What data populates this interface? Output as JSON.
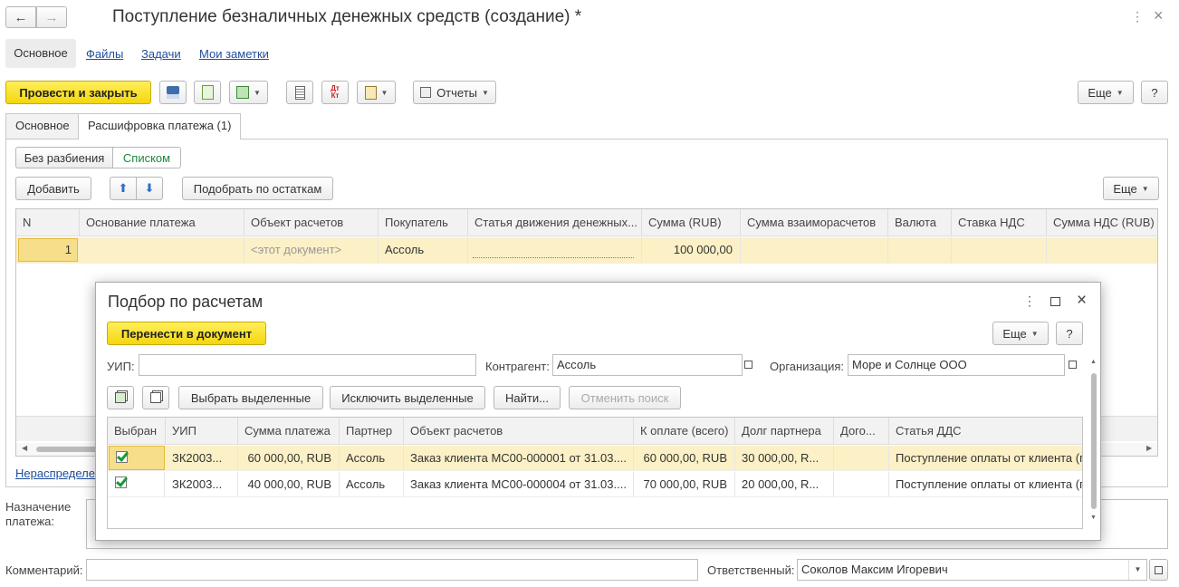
{
  "window": {
    "title": "Поступление безналичных денежных средств (создание) *"
  },
  "nav": {
    "main": "Основное",
    "files": "Файлы",
    "tasks": "Задачи",
    "notes": "Мои заметки"
  },
  "toolbar": {
    "post_close": "Провести и закрыть",
    "reports": "Отчеты",
    "more": "Еще",
    "help": "?"
  },
  "tabs": {
    "main": "Основное",
    "breakdown": "Расшифровка платежа (1)"
  },
  "split": {
    "no_split": "Без разбиения",
    "list": "Списком"
  },
  "table_toolbar": {
    "add": "Добавить",
    "pick_balance": "Подобрать по остаткам",
    "more": "Еще"
  },
  "grid": {
    "columns": [
      "N",
      "Основание платежа",
      "Объект расчетов",
      "Покупатель",
      "Статья движения денежных...",
      "Сумма (RUB)",
      "Сумма взаиморасчетов",
      "Валюта",
      "Ставка НДС",
      "Сумма НДС (RUB)"
    ],
    "rows": [
      {
        "n": "1",
        "basis": "",
        "object": "<этот документ>",
        "buyer": "Ассоль",
        "item": "",
        "sum": "100 000,00",
        "settle": "",
        "currency": "",
        "vat_rate": "",
        "vat_sum": ""
      }
    ]
  },
  "unallocated_link": "Нераспределе",
  "form": {
    "purpose_label": "Назначение платежа:",
    "comment_label": "Комментарий:",
    "comment_value": "",
    "responsible_label": "Ответственный:",
    "responsible_value": "Соколов Максим Игоревич"
  },
  "dialog": {
    "title": "Подбор по расчетам",
    "transfer": "Перенести в документ",
    "more": "Еще",
    "help": "?",
    "uip_label": "УИП:",
    "uip_value": "",
    "contractor_label": "Контрагент:",
    "contractor_value": "Ассоль",
    "org_label": "Организация:",
    "org_value": "Море и Солнце ООО",
    "select_selected": "Выбрать выделенные",
    "exclude_selected": "Исключить выделенные",
    "find": "Найти...",
    "cancel_search": "Отменить поиск",
    "columns": [
      "Выбран",
      "УИП",
      "Сумма платежа",
      "Партнер",
      "Объект расчетов",
      "К оплате (всего)",
      "Долг партнера",
      "Дого...",
      "Статья ДДС"
    ],
    "rows": [
      {
        "uip": "ЗК2003...",
        "sum": "60 000,00, RUB",
        "partner": "Ассоль",
        "object": "Заказ клиента МС00-000001 от 31.03....",
        "to_pay": "60 000,00, RUB",
        "debt": "30 000,00, R...",
        "contract": "",
        "dds": "Поступление оплаты от клиента (пр"
      },
      {
        "uip": "ЗК2003...",
        "sum": "40 000,00, RUB",
        "partner": "Ассоль",
        "object": "Заказ клиента МС00-000004 от 31.03....",
        "to_pay": "70 000,00, RUB",
        "debt": "20 000,00, R...",
        "contract": "",
        "dds": "Поступление оплаты от клиента (пр"
      }
    ]
  }
}
